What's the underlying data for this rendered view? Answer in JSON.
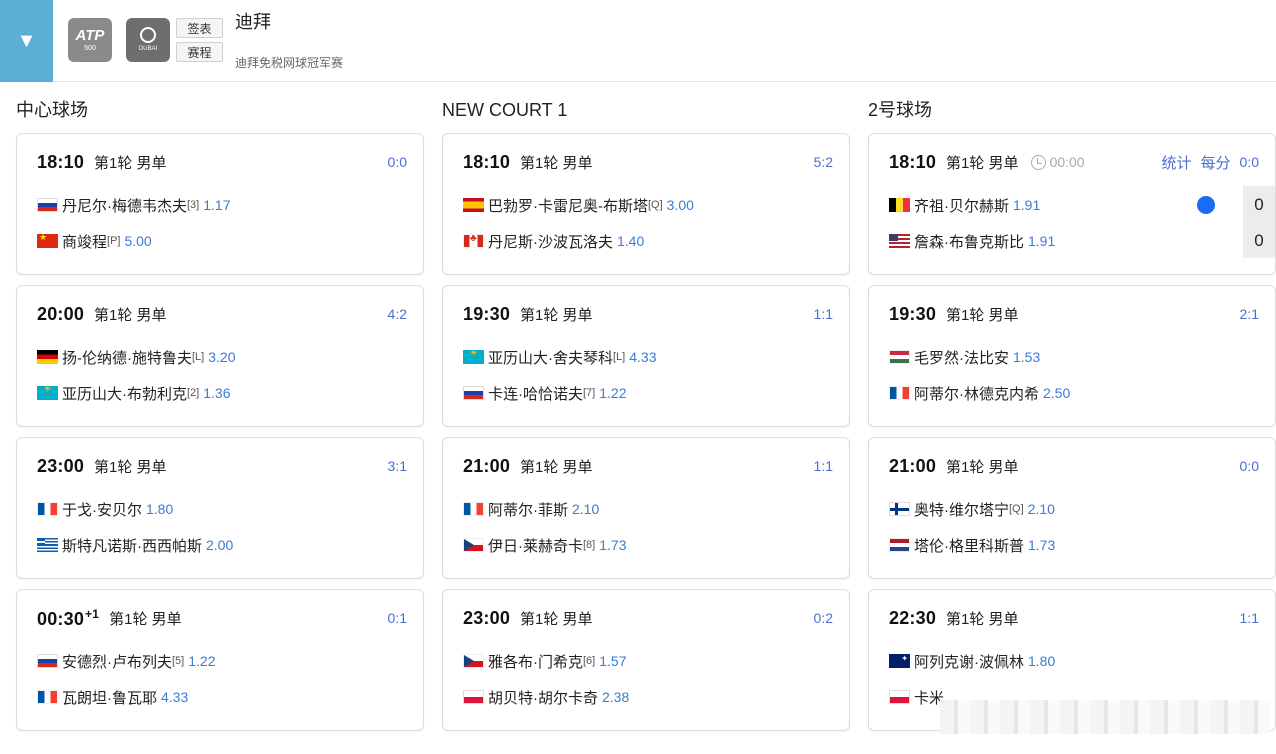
{
  "header": {
    "toggle_glyph": "▼",
    "logo_atp": {
      "big": "ATP",
      "small": "500"
    },
    "logo_dubai": {
      "text": "DUBAI"
    },
    "draw_label": "签表",
    "schedule_label": "赛程",
    "title": "迪拜",
    "subtitle": "迪拜免税网球冠军赛"
  },
  "columns": [
    {
      "court": "中心球场",
      "matches": [
        {
          "time": "18:10",
          "sup": "",
          "round": "第1轮 男单",
          "h2h": "0:0",
          "p1": {
            "flag": "ru",
            "name": "丹尼尔·梅德韦杰夫",
            "seed": "[3]",
            "odds": "1.17"
          },
          "p2": {
            "flag": "cn",
            "name": "商竣程",
            "seed": "[P]",
            "odds": "5.00"
          }
        },
        {
          "time": "20:00",
          "sup": "",
          "round": "第1轮 男单",
          "h2h": "4:2",
          "p1": {
            "flag": "de",
            "name": "扬-伦纳德·施特鲁夫",
            "seed": "[L]",
            "odds": "3.20"
          },
          "p2": {
            "flag": "kz",
            "name": "亚历山大·布勃利克",
            "seed": "[2]",
            "odds": "1.36"
          }
        },
        {
          "time": "23:00",
          "sup": "",
          "round": "第1轮 男单",
          "h2h": "3:1",
          "p1": {
            "flag": "fr",
            "name": "于戈·安贝尔",
            "seed": "",
            "odds": "1.80"
          },
          "p2": {
            "flag": "gr",
            "name": "斯特凡诺斯·西西帕斯",
            "seed": "",
            "odds": "2.00"
          }
        },
        {
          "time": "00:30",
          "sup": "+1",
          "round": "第1轮 男单",
          "h2h": "0:1",
          "p1": {
            "flag": "ru",
            "name": "安德烈·卢布列夫",
            "seed": "[5]",
            "odds": "1.22"
          },
          "p2": {
            "flag": "fr",
            "name": "瓦朗坦·鲁瓦耶",
            "seed": "",
            "odds": "4.33"
          }
        }
      ]
    },
    {
      "court": "NEW COURT 1",
      "matches": [
        {
          "time": "18:10",
          "sup": "",
          "round": "第1轮 男单",
          "h2h": "5:2",
          "p1": {
            "flag": "es",
            "name": "巴勃罗·卡雷尼奥-布斯塔",
            "seed": "[Q]",
            "odds": "3.00"
          },
          "p2": {
            "flag": "ca",
            "name": "丹尼斯·沙波瓦洛夫",
            "seed": "",
            "odds": "1.40"
          }
        },
        {
          "time": "19:30",
          "sup": "",
          "round": "第1轮 男单",
          "h2h": "1:1",
          "p1": {
            "flag": "kz",
            "name": "亚历山大·舍夫琴科",
            "seed": "[L]",
            "odds": "4.33"
          },
          "p2": {
            "flag": "ru",
            "name": "卡连·哈恰诺夫",
            "seed": "[7]",
            "odds": "1.22"
          }
        },
        {
          "time": "21:00",
          "sup": "",
          "round": "第1轮 男单",
          "h2h": "1:1",
          "p1": {
            "flag": "fr",
            "name": "阿蒂尔·菲斯",
            "seed": "",
            "odds": "2.10"
          },
          "p2": {
            "flag": "cz",
            "name": "伊日·莱赫奇卡",
            "seed": "[8]",
            "odds": "1.73"
          }
        },
        {
          "time": "23:00",
          "sup": "",
          "round": "第1轮 男单",
          "h2h": "0:2",
          "p1": {
            "flag": "cz",
            "name": "雅各布·门希克",
            "seed": "[6]",
            "odds": "1.57"
          },
          "p2": {
            "flag": "pl",
            "name": "胡贝特·胡尔卡奇",
            "seed": "",
            "odds": "2.38"
          }
        }
      ]
    },
    {
      "court": "2号球场",
      "matches": [
        {
          "time": "18:10",
          "sup": "",
          "round": "第1轮 男单",
          "h2h": "0:0",
          "live": true,
          "clock": "00:00",
          "stats_label": "统计",
          "per_point_label": "每分",
          "scores": [
            "0",
            "0"
          ],
          "p1": {
            "flag": "be",
            "name": "齐祖·贝尔赫斯",
            "seed": "",
            "odds": "1.91"
          },
          "p2": {
            "flag": "us",
            "name": "詹森·布鲁克斯比",
            "seed": "",
            "odds": "1.91"
          }
        },
        {
          "time": "19:30",
          "sup": "",
          "round": "第1轮 男单",
          "h2h": "2:1",
          "p1": {
            "flag": "hu",
            "name": "毛罗然·法比安",
            "seed": "",
            "odds": "1.53"
          },
          "p2": {
            "flag": "fr",
            "name": "阿蒂尔·林德克内希",
            "seed": "",
            "odds": "2.50"
          }
        },
        {
          "time": "21:00",
          "sup": "",
          "round": "第1轮 男单",
          "h2h": "0:0",
          "p1": {
            "flag": "fi",
            "name": "奥特·维尔塔宁",
            "seed": "[Q]",
            "odds": "2.10"
          },
          "p2": {
            "flag": "nl",
            "name": "塔伦·格里科斯普",
            "seed": "",
            "odds": "1.73"
          }
        },
        {
          "time": "22:30",
          "sup": "",
          "round": "第1轮 男单",
          "h2h": "1:1",
          "p1": {
            "flag": "au",
            "name": "阿列克谢·波佩林",
            "seed": "",
            "odds": "1.80"
          },
          "p2": {
            "flag": "pl",
            "name": "卡米",
            "seed": "",
            "odds": ""
          }
        }
      ]
    }
  ],
  "colors": {
    "accent": "#5ab0d4",
    "link": "#4a6fd0",
    "odds": "#3a7bd5",
    "serve": "#1a6cf0"
  }
}
